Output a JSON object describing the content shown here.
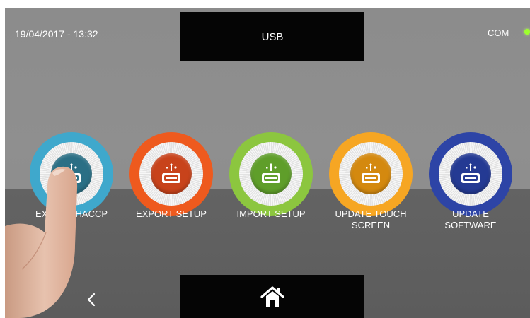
{
  "status_bar": {
    "datetime": "19/04/2017 - 13:32",
    "title": "USB",
    "com_label": "COM",
    "com_led_color": "#9dff2d"
  },
  "usb_buttons": [
    {
      "label_lines": [
        "EXPORT HACCP",
        ""
      ],
      "ring_color": "#3fa8cc",
      "core_color": "#2b6f85",
      "icon": "usb-icon"
    },
    {
      "label_lines": [
        "EXPORT SETUP",
        ""
      ],
      "ring_color": "#ee5a1e",
      "core_color": "#c8431b",
      "icon": "usb-icon"
    },
    {
      "label_lines": [
        "IMPORT SETUP",
        ""
      ],
      "ring_color": "#8cc63f",
      "core_color": "#5f9e2a",
      "icon": "usb-icon"
    },
    {
      "label_lines": [
        "UPDATE TOUCH",
        "SCREEN"
      ],
      "ring_color": "#f6a623",
      "core_color": "#d4890f",
      "icon": "usb-icon"
    },
    {
      "label_lines": [
        "UPDATE",
        "SOFTWARE"
      ],
      "ring_color": "#2d44a6",
      "core_color": "#243a93",
      "icon": "usb-icon"
    }
  ],
  "navigation": {
    "back_icon": "chevron-left-icon",
    "home_icon": "home-icon"
  }
}
